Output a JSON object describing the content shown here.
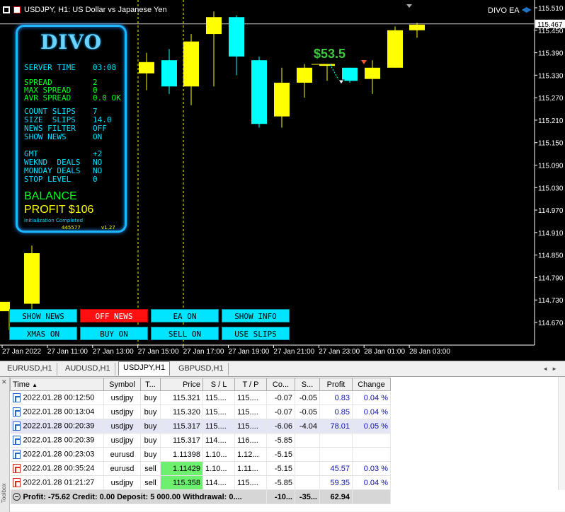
{
  "chart": {
    "title": "USDJPY, H1:  US Dollar vs Japanese Yen",
    "ea_label": "DIVO EA",
    "current_price": "115.467",
    "profit_label": "$53.5",
    "price_axis": [
      "115.510",
      "115.450",
      "115.390",
      "115.330",
      "115.270",
      "115.210",
      "115.150",
      "115.090",
      "115.030",
      "114.970",
      "114.910",
      "114.850",
      "114.790",
      "114.730",
      "114.670"
    ],
    "time_axis": [
      "27 Jan 2022",
      "27 Jan 11:00",
      "27 Jan 13:00",
      "27 Jan 15:00",
      "27 Jan 17:00",
      "27 Jan 19:00",
      "27 Jan 21:00",
      "27 Jan 23:00",
      "28 Jan 01:00",
      "28 Jan 03:00"
    ],
    "colors": {
      "bull": "#ffff00",
      "bear": "#00ffff",
      "vline": "#ffff00"
    }
  },
  "chart_data": {
    "type": "candlestick",
    "symbol": "USDJPY",
    "timeframe": "H1",
    "candles": [
      {
        "o": 114.7,
        "h": 114.72,
        "l": 114.65,
        "c": 114.725,
        "dir": "up"
      },
      {
        "o": 114.72,
        "h": 114.875,
        "l": 114.7,
        "c": 114.855,
        "dir": "up"
      },
      {
        "o": 115.335,
        "h": 115.39,
        "l": 115.29,
        "c": 115.365,
        "dir": "up"
      },
      {
        "o": 115.37,
        "h": 115.4,
        "l": 115.28,
        "c": 115.3,
        "dir": "down"
      },
      {
        "o": 115.3,
        "h": 115.44,
        "l": 115.25,
        "c": 115.42,
        "dir": "up"
      },
      {
        "o": 115.44,
        "h": 115.5,
        "l": 115.3,
        "c": 115.485,
        "dir": "up"
      },
      {
        "o": 115.485,
        "h": 115.49,
        "l": 115.33,
        "c": 115.38,
        "dir": "down"
      },
      {
        "o": 115.37,
        "h": 115.38,
        "l": 115.19,
        "c": 115.2,
        "dir": "down"
      },
      {
        "o": 115.22,
        "h": 115.35,
        "l": 115.19,
        "c": 115.31,
        "dir": "up"
      },
      {
        "o": 115.31,
        "h": 115.36,
        "l": 115.27,
        "c": 115.35,
        "dir": "up"
      },
      {
        "o": 115.36,
        "h": 115.355,
        "l": 115.315,
        "c": 115.355,
        "dir": "up"
      },
      {
        "o": 115.35,
        "h": 115.35,
        "l": 115.31,
        "c": 115.315,
        "dir": "down"
      },
      {
        "o": 115.32,
        "h": 115.37,
        "l": 115.28,
        "c": 115.35,
        "dir": "up"
      },
      {
        "o": 115.35,
        "h": 115.46,
        "l": 115.35,
        "c": 115.45,
        "dir": "up"
      },
      {
        "o": 115.45,
        "h": 115.47,
        "l": 115.43,
        "c": 115.465,
        "dir": "up"
      }
    ]
  },
  "panel": {
    "logo": "DIVO",
    "rows_cyan_1": {
      "k": "SERVER TIME",
      "v": "03:08"
    },
    "rows_green": [
      {
        "k": "SPREAD",
        "v": "2"
      },
      {
        "k": "MAX SPREAD",
        "v": "0"
      },
      {
        "k": "AVR SPREAD",
        "v": "0.0 OK"
      }
    ],
    "rows_cyan_2": [
      {
        "k": "COUNT SLIPS",
        "v": "7"
      },
      {
        "k": "SIZE  SLIPS",
        "v": "14.0"
      },
      {
        "k": "NEWS FILTER",
        "v": "OFF"
      },
      {
        "k": "SHOW NEWS",
        "v": "ON"
      }
    ],
    "rows_cyan_3": [
      {
        "k": "GMT",
        "v": "+2"
      },
      {
        "k": "WEKND  DEALS",
        "v": "NO"
      },
      {
        "k": "MONDAY DEALS",
        "v": "NO"
      },
      {
        "k": "STOP LEVEL",
        "v": "0"
      }
    ],
    "balance": "BALANCE",
    "profit": "PROFIT $106",
    "status": "Initialization Completed",
    "account": "445577",
    "version": "v1.27"
  },
  "buttons": [
    "SHOW NEWS",
    "OFF NEWS",
    "EA ON",
    "SHOW INFO",
    "XMAS ON",
    "BUY ON",
    "SELL ON",
    "USE SLIPS"
  ],
  "tabs": [
    "EURUSD,H1",
    "AUDUSD,H1",
    "USDJPY,H1",
    "GBPUSD,H1"
  ],
  "table": {
    "headers": [
      "Time",
      "Symbol",
      "T...",
      "Price",
      "S / L",
      "T / P",
      "Co...",
      "S...",
      "Profit",
      "Change"
    ],
    "rows": [
      [
        "2022.01.28 00:12:50",
        "usdjpy",
        "buy",
        "115.321",
        "115....",
        "115....",
        "-0.07",
        "-0.05",
        "0.83",
        "0.04 %"
      ],
      [
        "2022.01.28 00:13:04",
        "usdjpy",
        "buy",
        "115.320",
        "115....",
        "115....",
        "-0.07",
        "-0.05",
        "0.85",
        "0.04 %"
      ],
      [
        "2022.01.28 00:20:39",
        "usdjpy",
        "buy",
        "115.317",
        "115....",
        "115....",
        "-6.06",
        "-4.04",
        "78.01",
        "0.05 %"
      ],
      [
        "2022.01.28 00:20:39",
        "usdjpy",
        "buy",
        "115.317",
        "114....",
        "116....",
        "-5.85",
        "",
        "",
        ""
      ],
      [
        "2022.01.28 00:23:03",
        "eurusd",
        "buy",
        "1.11398",
        "1.10...",
        "1.12...",
        "-5.15",
        "",
        "",
        ""
      ],
      [
        "2022.01.28 00:35:24",
        "eurusd",
        "sell",
        "1.11429",
        "1.10...",
        "1.11...",
        "-5.15",
        "",
        "45.57",
        "0.03 %"
      ],
      [
        "2022.01.28 01:21:27",
        "usdjpy",
        "sell",
        "115.358",
        "114....",
        "115....",
        "-5.85",
        "",
        "59.35",
        "0.04 %"
      ]
    ],
    "total": {
      "summary": "Profit: -75.62  Credit: 0.00  Deposit: 5 000.00  Withdrawal: 0....",
      "comm": "-10...",
      "swap": "-35...",
      "profit": "62.94"
    }
  },
  "toolbox_label": "Toolbox"
}
